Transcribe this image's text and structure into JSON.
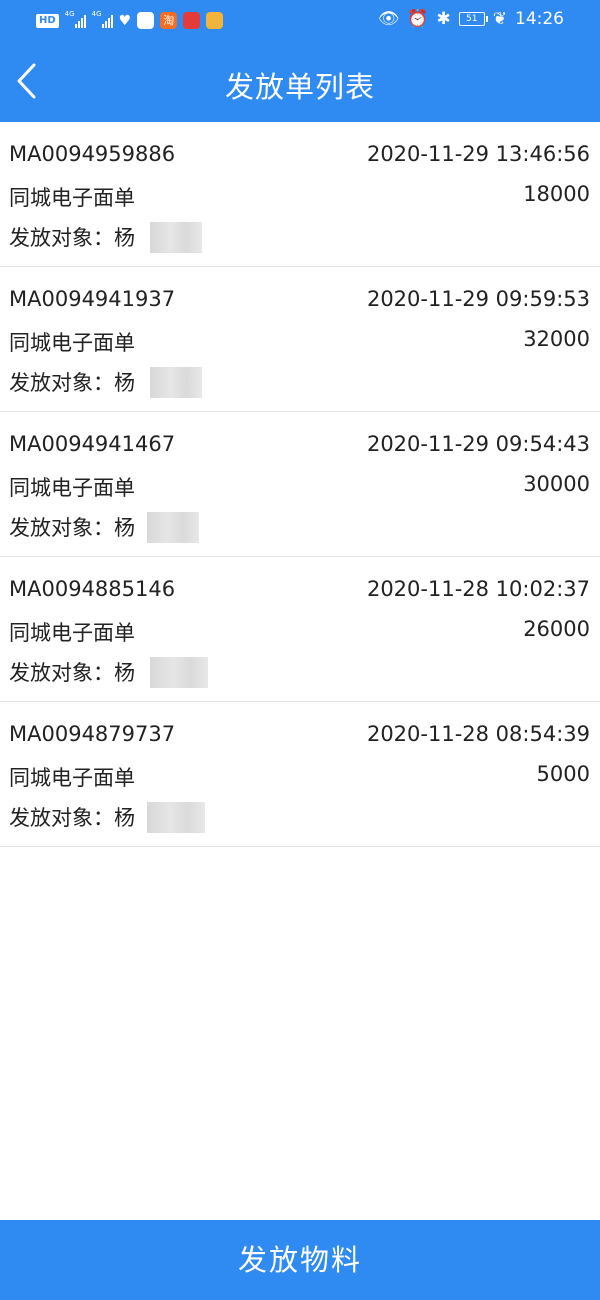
{
  "status_bar": {
    "hd_label": "HD",
    "signal1_tag": "4G",
    "signal2_tag": "4G",
    "app_icon_text": "淘",
    "battery_level": "51",
    "time": "14:26"
  },
  "header": {
    "title": "发放单列表"
  },
  "orders": [
    {
      "no": "MA0094959886",
      "time": "2020-11-29 13:46:56",
      "type": "同城电子面单",
      "qty": "18000",
      "target": "发放对象：杨"
    },
    {
      "no": "MA0094941937",
      "time": "2020-11-29 09:59:53",
      "type": "同城电子面单",
      "qty": "32000",
      "target": "发放对象：杨"
    },
    {
      "no": "MA0094941467",
      "time": "2020-11-29 09:54:43",
      "type": "同城电子面单",
      "qty": "30000",
      "target": "发放对象：杨"
    },
    {
      "no": "MA0094885146",
      "time": "2020-11-28 10:02:37",
      "type": "同城电子面单",
      "qty": "26000",
      "target": "发放对象：杨"
    },
    {
      "no": "MA0094879737",
      "time": "2020-11-28 08:54:39",
      "type": "同城电子面单",
      "qty": "5000",
      "target": "发放对象：杨"
    }
  ],
  "footer": {
    "button_label": "发放物料"
  },
  "colors": {
    "primary": "#2f8af2",
    "divider": "#e4e4e4"
  }
}
